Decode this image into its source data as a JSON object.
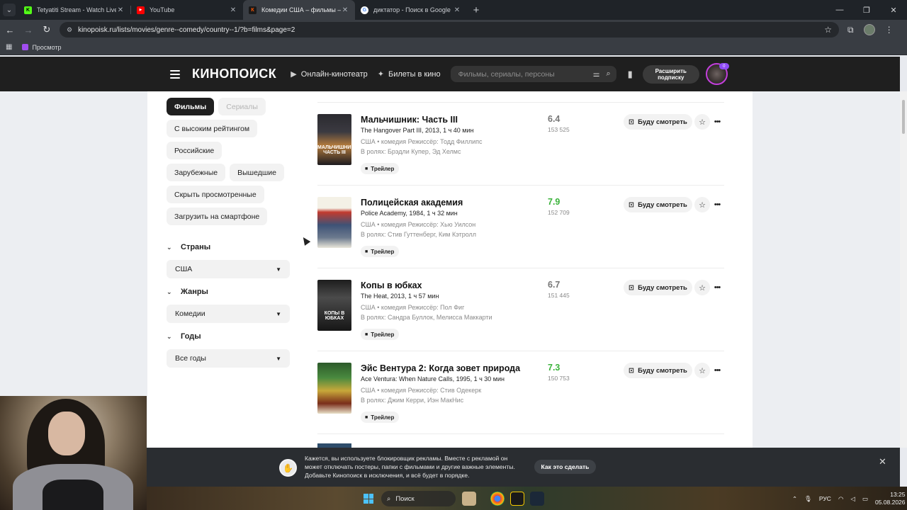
{
  "browser": {
    "tabs": [
      {
        "title": "Tetyatiti Stream - Watch Live on",
        "favicon_color": "#53fc18",
        "favicon_text": "K",
        "active": false
      },
      {
        "title": "YouTube",
        "favicon_color": "#ff0000",
        "favicon_text": "▶",
        "active": false
      },
      {
        "title": "Комедии США – фильмы — Кинопоиск",
        "favicon_color": "#ff5500",
        "favicon_text": "К",
        "active": true
      },
      {
        "title": "диктатор - Поиск в Google",
        "favicon_color": "#ffffff",
        "favicon_text": "G",
        "active": false
      }
    ],
    "url": "kinopoisk.ru/lists/movies/genre--comedy/country--1/?b=films&page=2",
    "bookmarks": [
      {
        "label": "Просмотр"
      }
    ]
  },
  "header": {
    "logo": "КИНОПОИСК",
    "nav": [
      {
        "label": "Онлайн-кинотеатр",
        "icon": "play-icon"
      },
      {
        "label": "Билеты в кино",
        "icon": "ticket-icon"
      }
    ],
    "search_placeholder": "Фильмы, сериалы, персоны",
    "subscription_line1": "Расширить",
    "subscription_line2": "подписку",
    "avatar_badge": "0"
  },
  "filters": {
    "type_chips": [
      {
        "label": "Фильмы",
        "state": "active"
      },
      {
        "label": "Сериалы",
        "state": "disabled"
      }
    ],
    "chips": [
      [
        "С высоким рейтингом"
      ],
      [
        "Российские"
      ],
      [
        "Зарубежные",
        "Вышедшие"
      ],
      [
        "Скрыть просмотренные"
      ],
      [
        "Загрузить на смартфоне"
      ]
    ],
    "groups": [
      {
        "title": "Страны",
        "value": "США"
      },
      {
        "title": "Жанры",
        "value": "Комедии"
      },
      {
        "title": "Годы",
        "value": "Все годы"
      }
    ]
  },
  "movies": [
    {
      "title": "Мальчишник: Часть III",
      "original": "The Hangover Part III, 2013, 1 ч 40 мин",
      "meta": "США • комедия  Режиссёр: Тодд Филлипс",
      "cast": "В ролях: Брэдли Купер, Эд Хелмс",
      "rating": "6.4",
      "votes": "153 525",
      "rating_color": "gray",
      "poster_text": "МАЛЬЧИШНИК ЧАСТЬ III"
    },
    {
      "title": "Полицейская академия",
      "original": "Police Academy, 1984, 1 ч 32 мин",
      "meta": "США • комедия  Режиссёр: Хью Уилсон",
      "cast": "В ролях: Стив Гуттенберг, Ким Кэтролл",
      "rating": "7.9",
      "votes": "152 709",
      "rating_color": "green",
      "poster_text": ""
    },
    {
      "title": "Копы в юбках",
      "original": "The Heat, 2013, 1 ч 57 мин",
      "meta": "США • комедия  Режиссёр: Пол Фиг",
      "cast": "В ролях: Сандра Буллок, Мелисса Маккарти",
      "rating": "6.7",
      "votes": "151 445",
      "rating_color": "gray",
      "poster_text": "КОПЫ В ЮБКАХ"
    },
    {
      "title": "Эйс Вентура 2: Когда зовет природа",
      "original": "Ace Ventura: When Nature Calls, 1995, 1 ч 30 мин",
      "meta": "США • комедия  Режиссёр: Стив Одекерк",
      "cast": "В ролях: Джим Керри, Иэн МакНис",
      "rating": "7.3",
      "votes": "150 753",
      "rating_color": "green",
      "poster_text": ""
    }
  ],
  "movie_actions": {
    "trailer": "Трейлер",
    "watchlist": "Буду смотреть"
  },
  "ad_banner": {
    "text": "Кажется, вы используете блокировщик рекламы. Вместе с рекламой он может отключать постеры, папки с фильмами и другие важные элементы. Добавьте Кинопоиск в исключения, и всё будет в порядке.",
    "button": "Как это сделать"
  },
  "taskbar": {
    "search": "Поиск",
    "language": "РУС",
    "time": "13:25",
    "date": "05.08.2026"
  },
  "colors": {
    "rating_green": "#3bb33b",
    "rating_gray": "#777777",
    "header_bg": "#1f1f1f",
    "avatar_ring": "#c33fdc"
  }
}
